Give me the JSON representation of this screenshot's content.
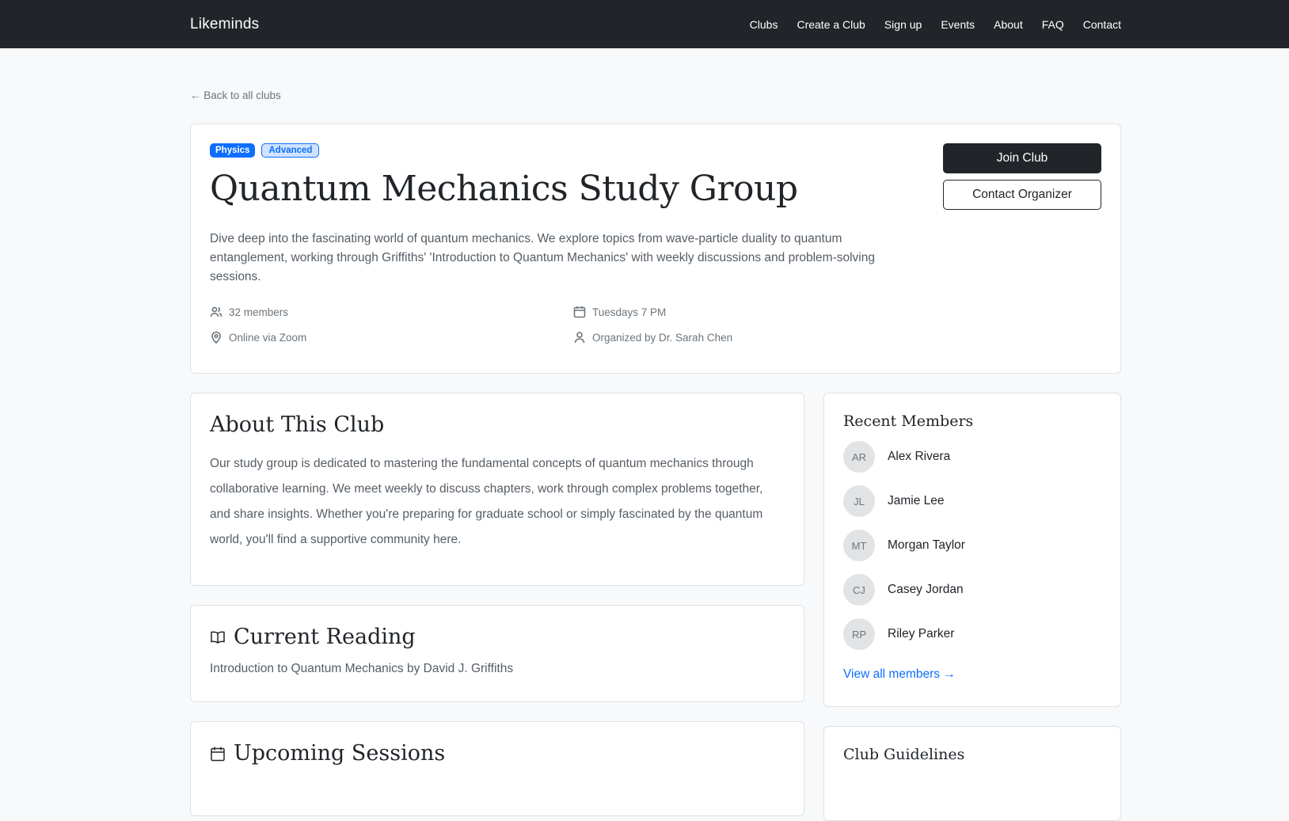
{
  "nav": {
    "brand": "Likeminds",
    "links": [
      "Clubs",
      "Create a Club",
      "Sign up",
      "Events",
      "About",
      "FAQ",
      "Contact"
    ]
  },
  "back_link": "← Back to all clubs",
  "club": {
    "badges": [
      "Physics",
      "Advanced"
    ],
    "title": "Quantum Mechanics Study Group",
    "description": "Dive deep into the fascinating world of quantum mechanics. We explore topics from wave-particle duality to quantum entanglement, working through Griffiths' 'Introduction to Quantum Mechanics' with weekly discussions and problem-solving sessions.",
    "members": "32 members",
    "schedule": "Tuesdays 7 PM",
    "location": "Online via Zoom",
    "organizer": "Organized by Dr. Sarah Chen",
    "join_label": "Join Club",
    "contact_label": "Contact Organizer"
  },
  "about": {
    "title": "About This Club",
    "text": "Our study group is dedicated to mastering the fundamental concepts of quantum mechanics through collaborative learning. We meet weekly to discuss chapters, work through complex problems together, and share insights. Whether you're preparing for graduate school or simply fascinated by the quantum world, you'll find a supportive community here."
  },
  "reading": {
    "title": "Current Reading",
    "text": "Introduction to Quantum Mechanics by David J. Griffiths"
  },
  "sessions": {
    "title": "Upcoming Sessions"
  },
  "recent_members": {
    "title": "Recent Members",
    "list": [
      {
        "initials": "AR",
        "name": "Alex Rivera"
      },
      {
        "initials": "JL",
        "name": "Jamie Lee"
      },
      {
        "initials": "MT",
        "name": "Morgan Taylor"
      },
      {
        "initials": "CJ",
        "name": "Casey Jordan"
      },
      {
        "initials": "RP",
        "name": "Riley Parker"
      }
    ],
    "view_all": "View all members →"
  },
  "guidelines": {
    "title": "Club Guidelines"
  },
  "colors": {
    "navbar": "#212529",
    "primary": "#0d6efd",
    "muted": "#6c757d"
  }
}
